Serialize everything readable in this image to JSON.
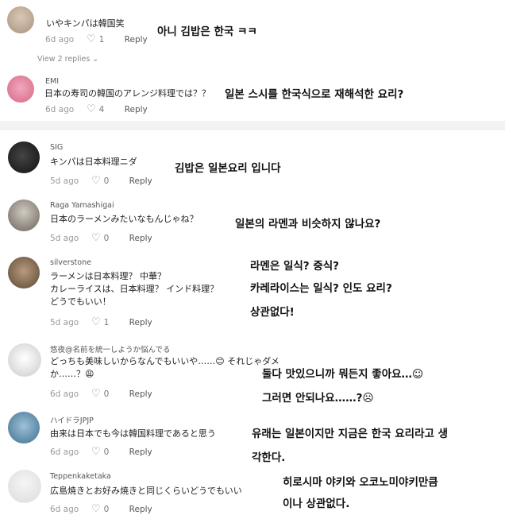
{
  "comments": [
    {
      "user": "いやキンパは韓国笑",
      "text": "",
      "age": "6d ago",
      "likes": "1",
      "reply": "Reply",
      "translation": [
        "아니 김밥은 한국 ㅋㅋ"
      ]
    },
    {
      "user": "EMI",
      "text": "日本の寿司の韓国のアレンジ料理では？？",
      "age": "6d ago",
      "likes": "4",
      "reply": "Reply",
      "translation": [
        "일본 스시를 한국식으로 재해석한 요리?"
      ]
    },
    {
      "user": "SIG",
      "text": "キンパは日本料理ニダ",
      "age": "5d ago",
      "likes": "0",
      "reply": "Reply",
      "translation": [
        "김밥은 일본요리 입니다"
      ]
    },
    {
      "user": "Raga Yamashigai",
      "text": "日本のラーメンみたいなもんじゃね？",
      "age": "5d ago",
      "likes": "0",
      "reply": "Reply",
      "translation": [
        "일본의 라멘과 비슷하지 않나요?"
      ]
    },
    {
      "user": "silverstone",
      "text": [
        "ラーメンは日本料理？ 中華？",
        "カレーライスは、日本料理？ インド料理？",
        "どうでもいい！"
      ],
      "age": "5d ago",
      "likes": "1",
      "reply": "Reply",
      "translation": [
        "라멘은 일식? 중식?",
        "카레라이스는 일식? 인도 요리?",
        "상관없다!"
      ]
    },
    {
      "user": "悠夜@名前を統一しようか悩んでる",
      "text": [
        "どっちも美味しいからなんでもいいや……😊 それじゃダメ",
        "か……？😩"
      ],
      "age": "6d ago",
      "likes": "0",
      "reply": "Reply",
      "translation": [
        "둘다 맛있으니까 뭐든지 좋아요…☺",
        "그러면 안되나요……?☹"
      ]
    },
    {
      "user": "ハイドラJPJP",
      "text": "由来は日本でも今は韓国料理であると思う",
      "age": "6d ago",
      "likes": "0",
      "reply": "Reply",
      "translation": [
        "유래는 일본이지만 지금은 한국 요리라고 생",
        "각한다."
      ]
    },
    {
      "user": "Teppenkaketaka",
      "text": "広島焼きとお好み焼きと同じくらいどうでもいい",
      "age": "6d ago",
      "likes": "0",
      "reply": "Reply",
      "translation": [
        "히로시마 야키와 오코노미야키만큼",
        "이나 상관없다."
      ]
    }
  ],
  "view_replies": "View 2 replies ⌄",
  "icons": {
    "heart": "heart-outline-icon"
  }
}
